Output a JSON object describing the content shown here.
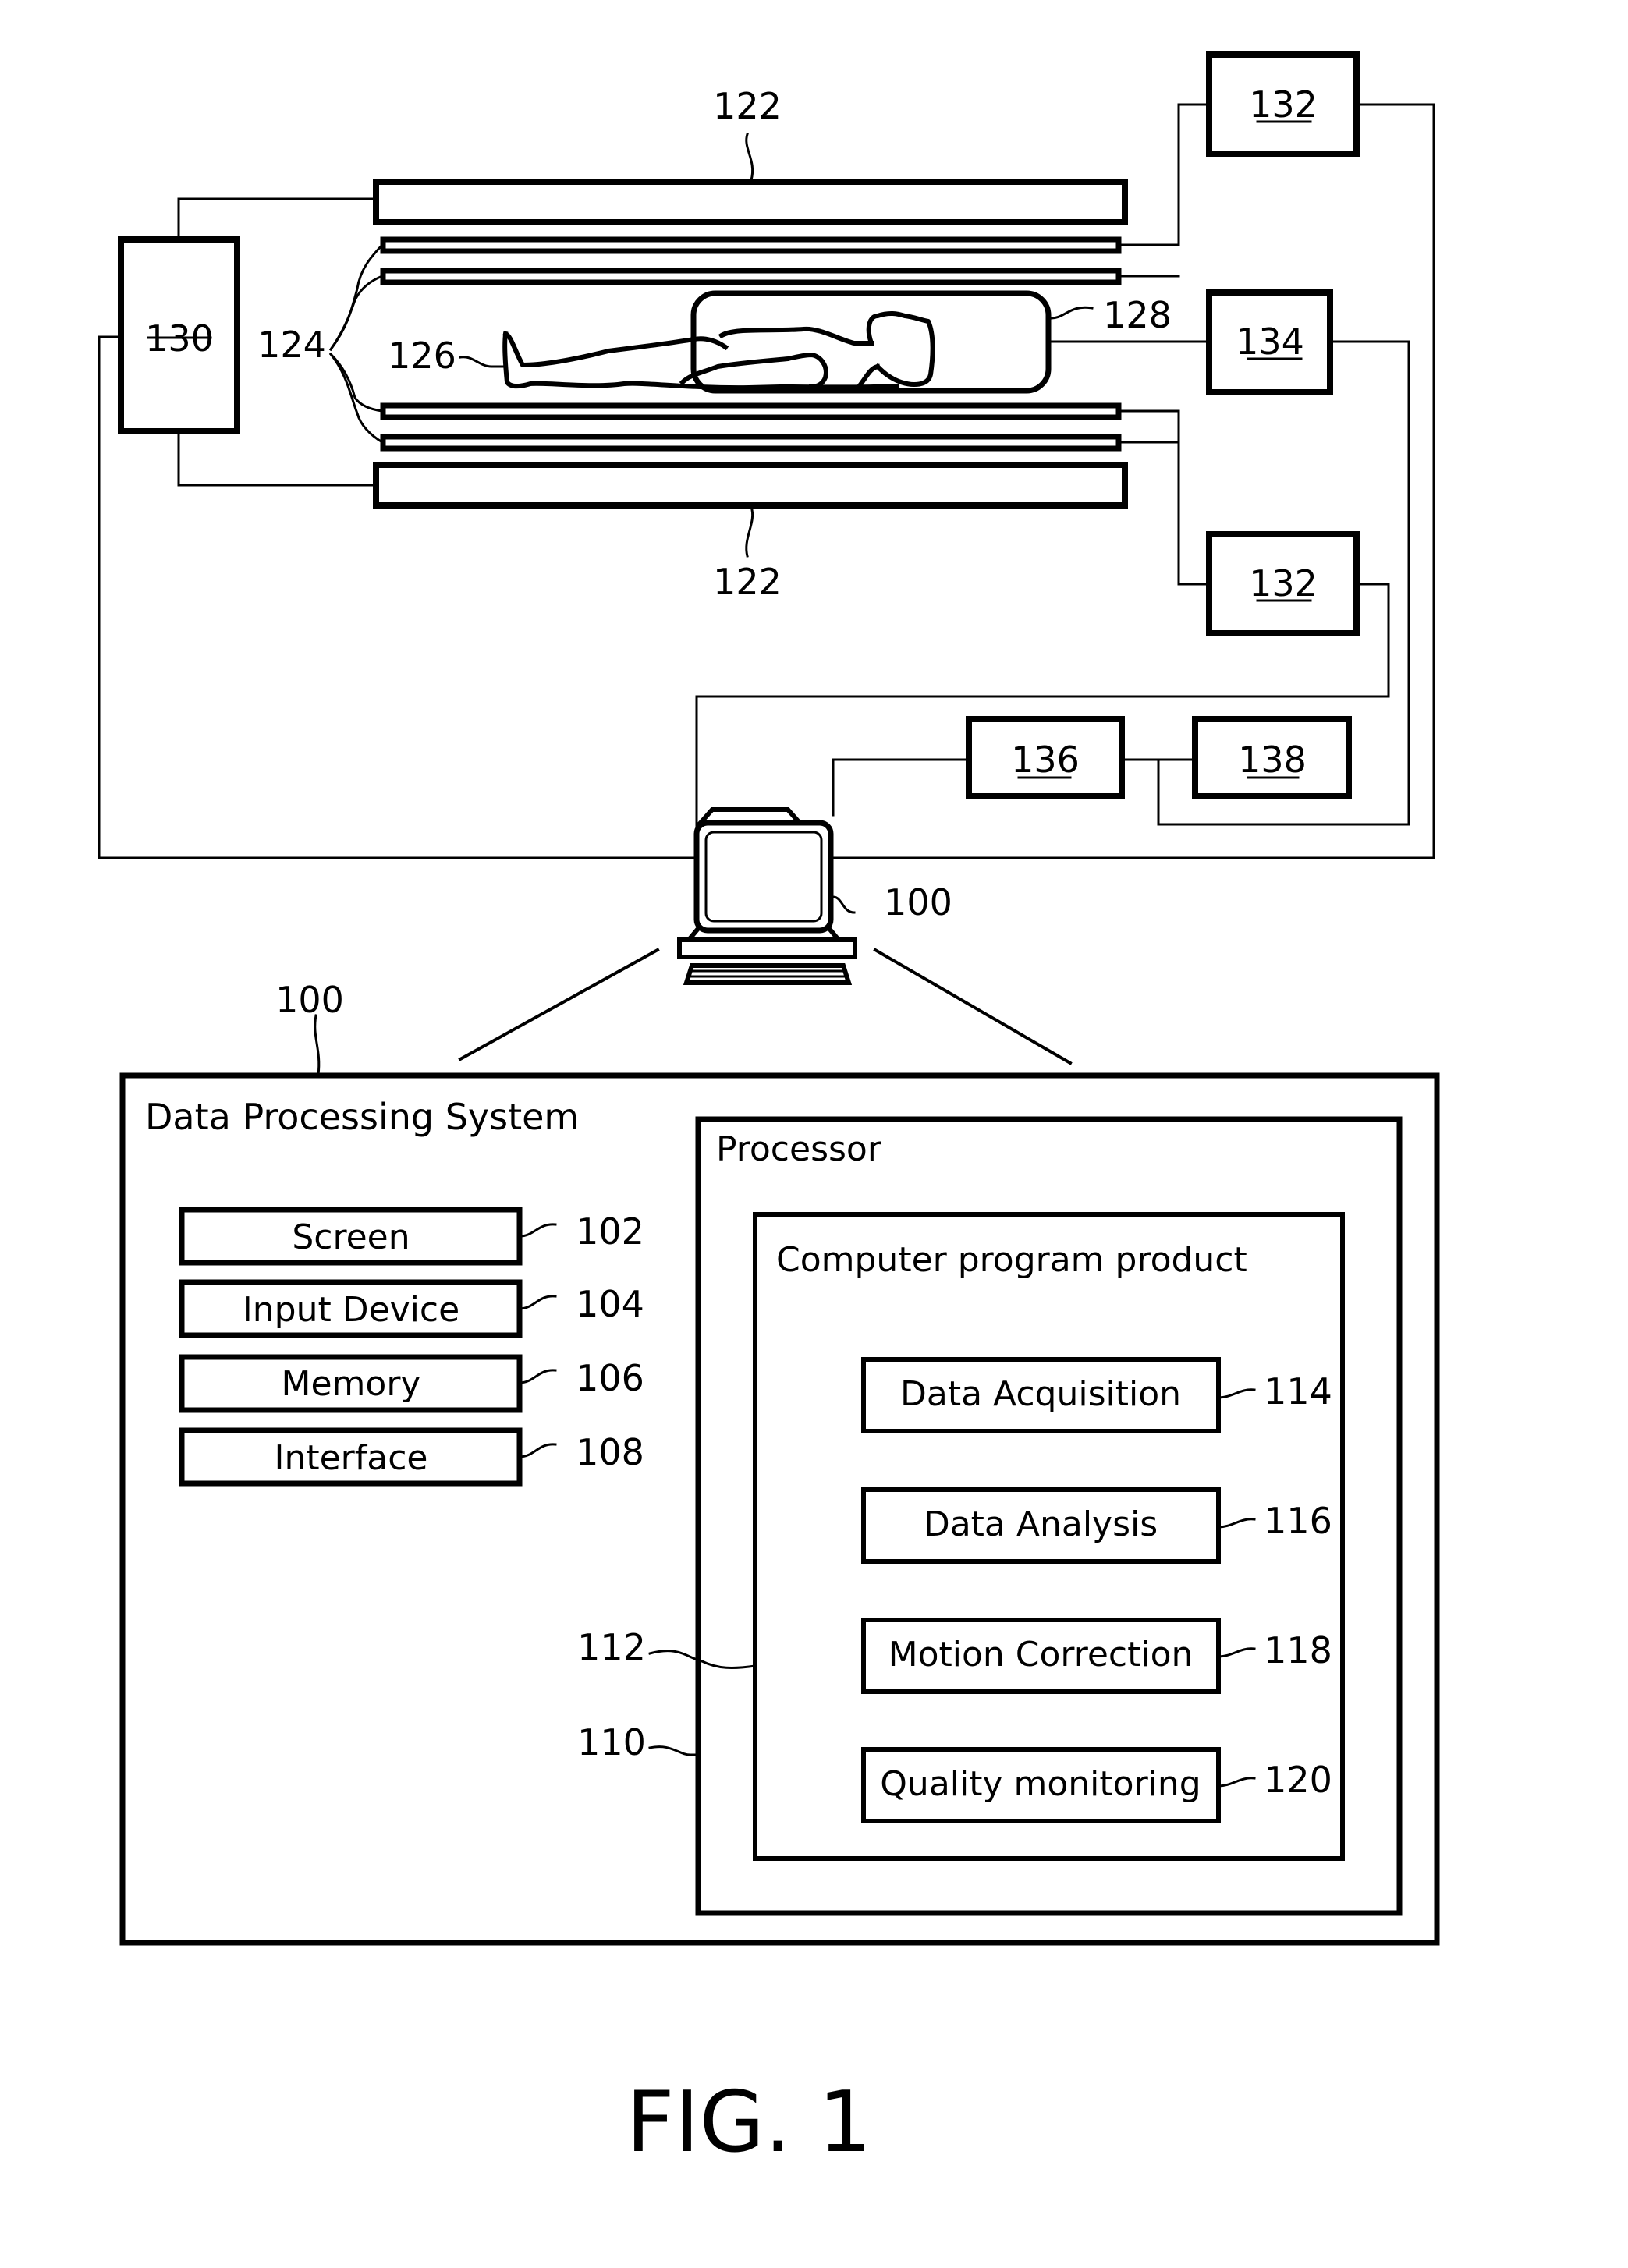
{
  "figure": {
    "caption": "FIG. 1",
    "colors": {
      "ink": "#000000",
      "paper": "#ffffff"
    }
  },
  "scanner": {
    "main_magnet_label": "122",
    "gradient_coils_label": "124",
    "subject_label": "126",
    "rf_coil_label": "128",
    "magnet_power_supply_label": "130",
    "gradient_amplifier_top_label": "132",
    "gradient_amplifier_bottom_label": "132",
    "rf_transceiver_label": "134",
    "unit_136_label": "136",
    "unit_138_label": "138",
    "computer_label": "100"
  },
  "system": {
    "ref_label": "100",
    "title": "Data Processing System",
    "components": [
      {
        "label": "Screen",
        "ref": "102"
      },
      {
        "label": "Input Device",
        "ref": "104"
      },
      {
        "label": "Memory",
        "ref": "106"
      },
      {
        "label": "Interface",
        "ref": "108"
      }
    ],
    "processor": {
      "title": "Processor",
      "ref": "110",
      "program_product": {
        "title": "Computer program product",
        "ref": "112",
        "modules": [
          {
            "label": "Data Acquisition",
            "ref": "114"
          },
          {
            "label": "Data Analysis",
            "ref": "116"
          },
          {
            "label": "Motion Correction",
            "ref": "118"
          },
          {
            "label": "Quality monitoring",
            "ref": "120"
          }
        ]
      }
    }
  }
}
